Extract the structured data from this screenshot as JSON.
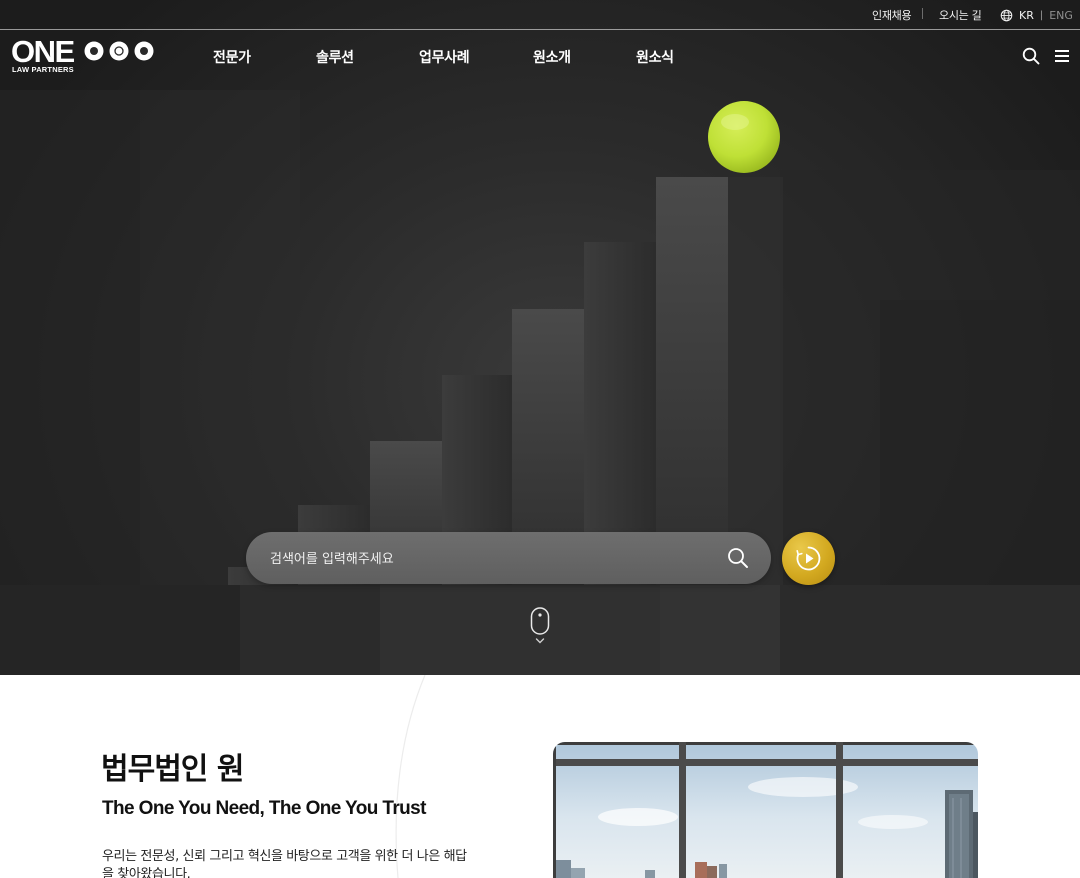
{
  "util": {
    "recruit": "인재채용",
    "directions": "오시는 길",
    "lang_kr": "KR",
    "lang_sep": "|",
    "lang_eng": "ENG"
  },
  "logo": {
    "word": "ONE",
    "sub": "LAW PARTNERS"
  },
  "nav": {
    "items": [
      "전문가",
      "솔루션",
      "업무사례",
      "원소개",
      "원소식"
    ]
  },
  "search": {
    "placeholder": "검색어를 입력해주세요"
  },
  "intro": {
    "title": "법무법인 원",
    "slogan": "The One You Need, The One You Trust",
    "description": "우리는 전문성, 신뢰 그리고 혁신을 바탕으로 고객을 위한 더 나은 해답을 찾아왔습니다."
  },
  "colors": {
    "hero_bg": "#2a2a2a",
    "accent_lime": "#c6e63a",
    "accent_gold": "#d3a920"
  },
  "icons": {
    "search": "search-icon",
    "menu": "hamburger-menu-icon",
    "globe": "globe-icon",
    "play": "play-circle-icon",
    "scroll": "mouse-scroll-icon"
  }
}
